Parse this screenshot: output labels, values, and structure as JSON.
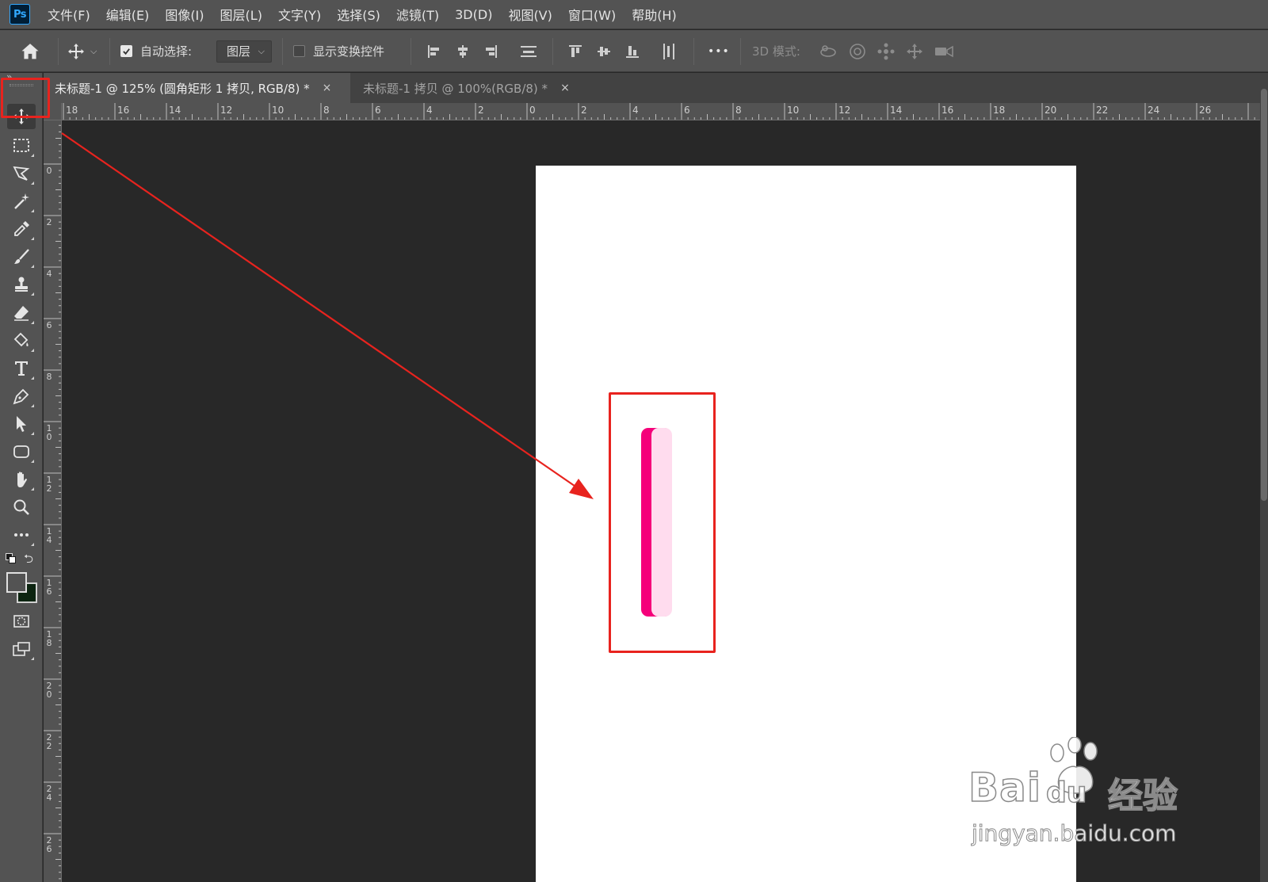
{
  "app": {
    "logo": "Ps"
  },
  "menu": [
    "文件(F)",
    "编辑(E)",
    "图像(I)",
    "图层(L)",
    "文字(Y)",
    "选择(S)",
    "滤镜(T)",
    "3D(D)",
    "视图(V)",
    "窗口(W)",
    "帮助(H)"
  ],
  "options": {
    "auto_select_label": "自动选择:",
    "auto_select_checked": true,
    "layer_dropdown": "图层",
    "show_transform_label": "显示变换控件",
    "show_transform_checked": false,
    "more": "•••",
    "mode_3d_label": "3D 模式:"
  },
  "tabs": [
    {
      "label": "未标题-1 @ 125% (圆角矩形 1 拷贝, RGB/8) *",
      "close": "×",
      "active": true
    },
    {
      "label": "未标题-1 拷贝 @ 100%(RGB/8) *",
      "close": "×",
      "active": false
    }
  ],
  "ruler": {
    "horizontal": [
      "18",
      "16",
      "14",
      "12",
      "10",
      "8",
      "6",
      "4",
      "2",
      "0",
      "2",
      "4",
      "6",
      "8",
      "10",
      "12",
      "14",
      "16",
      "18",
      "20",
      "22",
      "24",
      "26"
    ],
    "vertical": [
      "0",
      "2",
      "4",
      "6",
      "8",
      "10",
      "12",
      "14",
      "16",
      "18",
      "20",
      "22",
      "24",
      "26"
    ]
  },
  "canvas": {
    "shape_colors": {
      "dark": "#f5007a",
      "light": "#ffdcee"
    }
  },
  "annotation_color": "#e8231e",
  "watermark": {
    "brand": "Bai",
    "brand_tail": "du",
    "product": "经验",
    "url": "jingyan.baidu.com"
  },
  "colors": {
    "foreground": "#ffffff",
    "background": "#0c2410"
  }
}
